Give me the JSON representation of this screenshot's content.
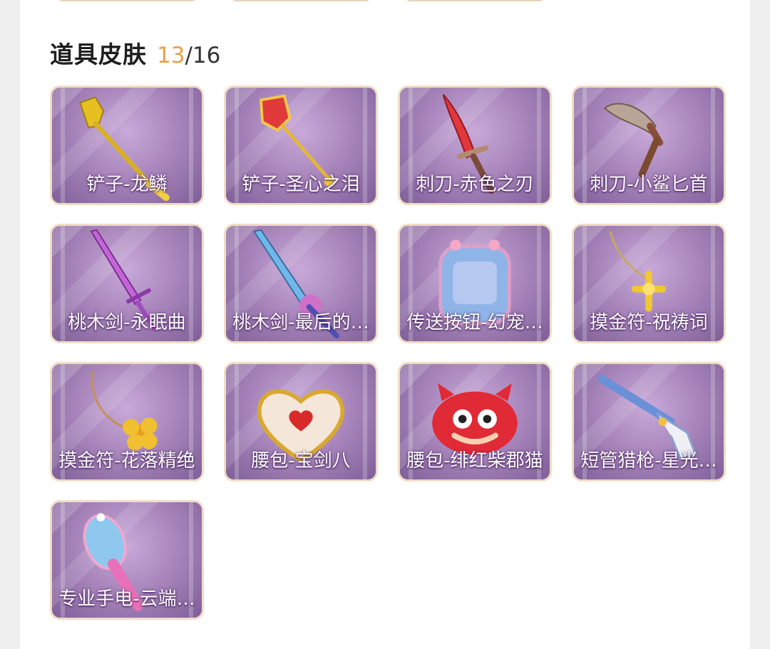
{
  "section": {
    "name": "道具皮肤",
    "owned": "13",
    "separator": "/",
    "total": "16"
  },
  "colors": {
    "owned_accent": "#e7a147",
    "card_border": "#f1dcc6",
    "card_bg": "#a987bd"
  },
  "items": [
    {
      "label": "铲子-龙鳞",
      "icon": "golden-shovel-icon"
    },
    {
      "label": "铲子-圣心之泪",
      "icon": "heart-shovel-icon"
    },
    {
      "label": "刺刀-赤色之刃",
      "icon": "red-dagger-icon"
    },
    {
      "label": "刺刀-小鲨匕首",
      "icon": "shark-dagger-icon"
    },
    {
      "label": "桃木剑-永眠曲",
      "icon": "purple-sword-icon"
    },
    {
      "label": "桃木剑-最后的…",
      "icon": "unicorn-sword-icon"
    },
    {
      "label": "传送按钮-幻宠…",
      "icon": "pet-device-icon"
    },
    {
      "label": "摸金符-祝祷词",
      "icon": "gold-cross-charm-icon"
    },
    {
      "label": "摸金符-花落精绝",
      "icon": "flower-charm-icon"
    },
    {
      "label": "腰包-宝剑八",
      "icon": "heart-pouch-icon"
    },
    {
      "label": "腰包-绯红柴郡猫",
      "icon": "red-cat-pouch-icon"
    },
    {
      "label": "短管猎枪-星光…",
      "icon": "shotgun-icon"
    },
    {
      "label": "专业手电-云端…",
      "icon": "pink-flashlight-icon"
    }
  ]
}
